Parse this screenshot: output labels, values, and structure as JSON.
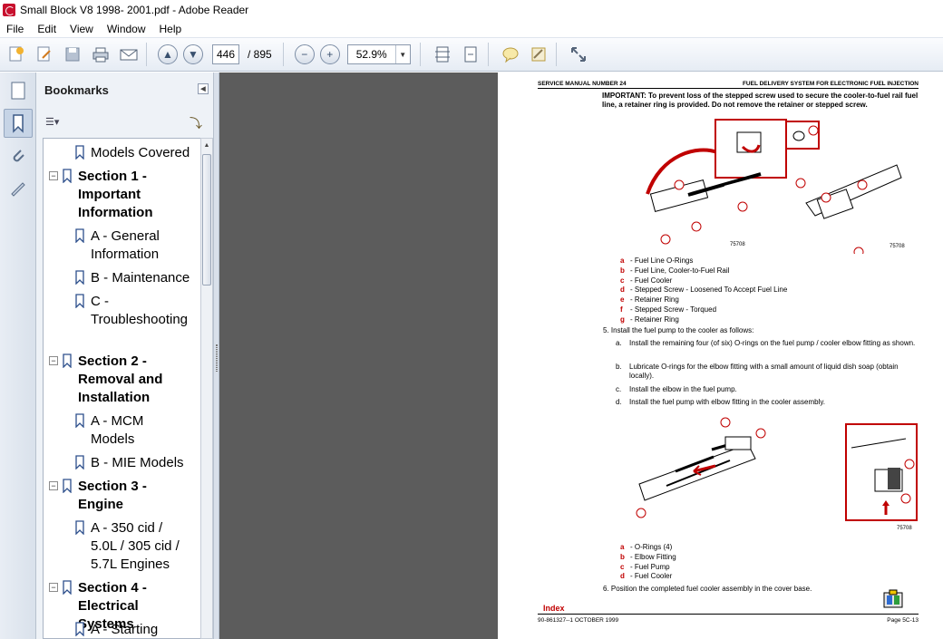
{
  "window": {
    "title": "Small Block V8 1998- 2001.pdf - Adobe Reader"
  },
  "menu": [
    "File",
    "Edit",
    "View",
    "Window",
    "Help"
  ],
  "toolbar": {
    "current_page": "446",
    "page_total": "/ 895",
    "zoom": "52.9%",
    "icons": [
      "create-pdf-icon",
      "edit-icon",
      "save-icon",
      "print-icon",
      "email-icon",
      "previous-page-icon",
      "next-page-icon",
      "zoom-out-icon",
      "zoom-in-icon",
      "fit-page-icon",
      "scroll-mode-icon",
      "comment-icon",
      "sign-icon",
      "fullscreen-icon"
    ]
  },
  "bookmarks": {
    "header": "Bookmarks",
    "items": [
      {
        "label": "Models Covered",
        "bold": false
      },
      {
        "label": "Section 1 - Important Information",
        "bold": true
      },
      {
        "label": "A - General Information",
        "bold": false
      },
      {
        "label": "B - Maintenance",
        "bold": false
      },
      {
        "label": "C - Troubleshooting",
        "bold": false
      },
      {
        "label": "Section 2 - Removal and Installation",
        "bold": true
      },
      {
        "label": "A - MCM Models",
        "bold": false
      },
      {
        "label": "B - MIE Models",
        "bold": false
      },
      {
        "label": "Section 3 - Engine",
        "bold": true
      },
      {
        "label": "A - 350 cid / 5.0L / 305 cid / 5.7L Engines",
        "bold": false
      },
      {
        "label": "Section 4 - Electrical Systems",
        "bold": true
      },
      {
        "label": "A - Starting",
        "bold": false
      }
    ]
  },
  "document": {
    "header_left": "SERVICE MANUAL NUMBER 24",
    "header_right": "FUEL DELIVERY SYSTEM FOR ELECTRONIC FUEL INJECTION",
    "important": "IMPORTANT: To prevent loss of the stepped screw used to secure the cooler-to-fuel rail fuel line, a retainer ring is provided. Do not remove the retainer or stepped screw.",
    "figure1_numbers": [
      "75708",
      "75708"
    ],
    "legend1": [
      {
        "letter": "a",
        "text": "- Fuel Line O-Rings"
      },
      {
        "letter": "b",
        "text": "- Fuel Line, Cooler-to-Fuel Rail"
      },
      {
        "letter": "c",
        "text": "- Fuel Cooler"
      },
      {
        "letter": "d",
        "text": "- Stepped Screw - Loosened To Accept Fuel Line"
      },
      {
        "letter": "e",
        "text": "- Retainer Ring"
      },
      {
        "letter": "f",
        "text": "- Stepped Screw - Torqued"
      },
      {
        "letter": "g",
        "text": "- Retainer Ring"
      }
    ],
    "step5": "5.   Install the fuel pump to the cooler as follows:",
    "substeps": [
      {
        "letter": "a.",
        "text": "Install the remaining four (of six) O-rings on the fuel pump / cooler elbow fitting as shown."
      },
      {
        "letter": "b.",
        "text": "Lubricate O-rings for the elbow fitting with a small amount of liquid dish soap (obtain locally)."
      },
      {
        "letter": "c.",
        "text": "Install the elbow in the fuel pump."
      },
      {
        "letter": "d.",
        "text": "Install the fuel pump with elbow fitting in the cooler assembly."
      }
    ],
    "figure2_number": "75708",
    "legend2": [
      {
        "letter": "a",
        "text": "- O-Rings (4)"
      },
      {
        "letter": "b",
        "text": "- Elbow Fitting"
      },
      {
        "letter": "c",
        "text": "- Fuel Pump"
      },
      {
        "letter": "d",
        "text": "- Fuel Cooler"
      }
    ],
    "step6": "6.   Position the completed fuel cooler assembly in the cover base.",
    "footer_index": "Index",
    "footer_left": "90-861327--1  OCTOBER 1999",
    "footer_right": "Page 5C-13"
  }
}
